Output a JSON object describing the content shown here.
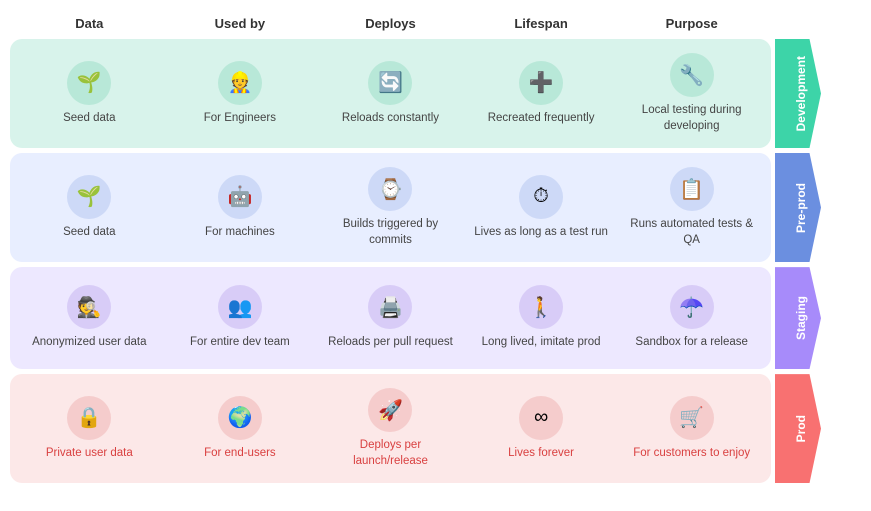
{
  "header": {
    "columns": [
      "Data",
      "Used by",
      "Deploys",
      "Lifespan",
      "Purpose"
    ]
  },
  "sections": [
    {
      "id": "dev",
      "label": "Development",
      "bgColor": "#d8f3eb",
      "tabColor": "#3dd4a8",
      "iconBg": "#b8e8d8",
      "iconColor": "#1aaa7e",
      "textClass": "dev-text",
      "cells": [
        {
          "icon": "🌱",
          "text": "Seed data"
        },
        {
          "icon": "👷",
          "text": "For Engineers"
        },
        {
          "icon": "🔄",
          "text": "Reloads constantly"
        },
        {
          "icon": "➕",
          "text": "Recreated frequently"
        },
        {
          "icon": "🔧",
          "text": "Local testing during developing"
        }
      ]
    },
    {
      "id": "preprod",
      "label": "Pre-prod",
      "bgColor": "#e8eeff",
      "tabColor": "#6b8fe0",
      "iconBg": "#cdd9f7",
      "iconColor": "#4b6fd0",
      "textClass": "preprod-text",
      "cells": [
        {
          "icon": "🌱",
          "text": "Seed data"
        },
        {
          "icon": "🤖",
          "text": "For machines"
        },
        {
          "icon": "⌚",
          "text": "Builds triggered by commits"
        },
        {
          "icon": "⏱",
          "text": "Lives as long as a test run"
        },
        {
          "icon": "📋",
          "text": "Runs automated tests & QA"
        }
      ]
    },
    {
      "id": "staging",
      "label": "Staging",
      "bgColor": "#ede8ff",
      "tabColor": "#a78bfa",
      "iconBg": "#d8ccf7",
      "iconColor": "#7c5ce6",
      "textClass": "staging-text",
      "cells": [
        {
          "icon": "🕵️",
          "text": "Anonymized user data"
        },
        {
          "icon": "👥",
          "text": "For entire dev team"
        },
        {
          "icon": "🖨️",
          "text": "Reloads per pull request"
        },
        {
          "icon": "🚶",
          "text": "Long lived, imitate prod"
        },
        {
          "icon": "☂️",
          "text": "Sandbox for a release"
        }
      ]
    },
    {
      "id": "prod",
      "label": "Prod",
      "bgColor": "#fce8e8",
      "tabColor": "#f87171",
      "iconBg": "#f5cccc",
      "iconColor": "#e04444",
      "textClass": "prod-text",
      "cells": [
        {
          "icon": "🔒",
          "text": "Private user data"
        },
        {
          "icon": "🌍",
          "text": "For end-users"
        },
        {
          "icon": "🚀",
          "text": "Deploys per launch/release"
        },
        {
          "icon": "∞",
          "text": "Lives forever"
        },
        {
          "icon": "🛒",
          "text": "For customers to enjoy"
        }
      ]
    }
  ]
}
